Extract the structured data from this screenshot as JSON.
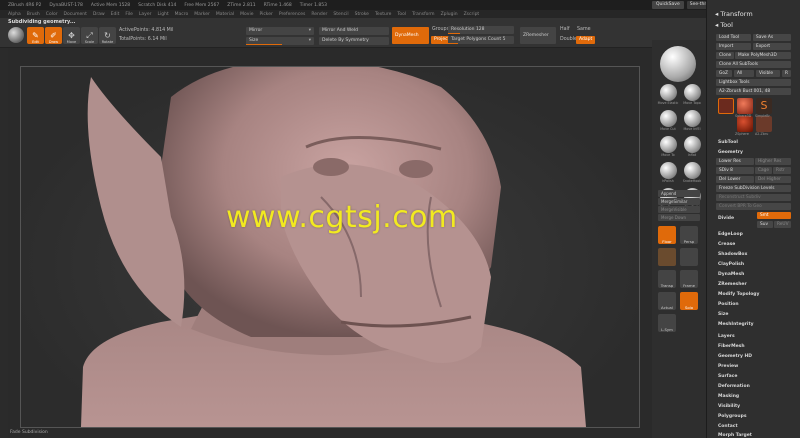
{
  "titlebar": {
    "app": "ZBrush 4R6 P2",
    "doc": "DynaBUST-178",
    "active_mem": "Active Mem 1528",
    "scratch": "Scratch Disk 414",
    "free_mem": "Free Mem 2567",
    "ztime": "ZTime 2.811",
    "rtime": "RTime 1.468",
    "timer": "Timer 1.853",
    "quicksave": "QuickSave",
    "see_through": "See-through",
    "see_through_value": 0,
    "menus": "Menus",
    "script": "DefaultZScript"
  },
  "menubar": [
    "Alpha",
    "Brush",
    "Color",
    "Document",
    "Draw",
    "Edit",
    "File",
    "Layer",
    "Light",
    "Macro",
    "Marker",
    "Material",
    "Movie",
    "Picker",
    "Preferences",
    "Render",
    "Stencil",
    "Stroke",
    "Texture",
    "Tool",
    "Transform",
    "Zplugin",
    "Zscript"
  ],
  "toolbar": {
    "sub_label": "Subdividing geometry...",
    "edit": "Edit",
    "draw": "Draw",
    "move": "Move",
    "scale": "Scale",
    "rotate": "Rotate",
    "active_points": "ActivePoints: 4.814 Mil",
    "total_points": "TotalPoints: 6.14 Mil",
    "mirror": "Mirror",
    "size": "Size",
    "mirror_weld": "Mirror And Weld",
    "delete_sym": "Delete By Symmetry",
    "dynamesh": "DynaMesh",
    "groups": "Groups",
    "project": "Project",
    "resolution": "Resolution 128",
    "target_polygons": "Target Polygons Count 5",
    "zremesher": "ZRemesher",
    "half": "Half",
    "same": "Same",
    "double": "Double",
    "adapt": "Adapt"
  },
  "watermark": "www.cgtsj.com",
  "status": "Fade Subdivision",
  "shelf": {
    "brushes": [
      "Move Elastic",
      "Move Topo",
      "Move Cut",
      "Move InfEl",
      "Move To",
      "Inflat",
      "hPolish",
      "SnakeHook",
      "TrimCurv",
      "ClayBuild"
    ],
    "append": "Append",
    "merge_similar": "MergeSimilar",
    "merge_visible": "MergeVisible",
    "merge_down": "Merge Down",
    "floor": "Floor",
    "persp": "Persp",
    "material": "MatCap",
    "transp": "Transp",
    "frame": "Frame",
    "actual": "Actual",
    "solo": "Solo",
    "lsym": "L.Sym"
  },
  "panel": {
    "transform": "Transform",
    "tool": "Tool",
    "load_tool": "Load Tool",
    "save_as": "Save As",
    "import": "Import",
    "export": "Export",
    "clone": "Clone",
    "make_polymesh": "Make PolyMesh3D",
    "clone_all": "Clone All SubTools",
    "goz": "GoZ",
    "all": "All",
    "visible": "Visible",
    "r": "R",
    "lightbox_tools": "Lightbox Tools",
    "brush_name": "A2-Zbrush Bust 001, 48",
    "thumb_labels": [
      "Sphere3D",
      "SimpleBr",
      "ZSphere",
      "A2-Zbru"
    ],
    "subtool": "SubTool",
    "geometry": "Geometry",
    "lower_res": "Lower Res",
    "higher_res": "Higher Res",
    "sdiv": "SDiv 8",
    "cage": "Cage",
    "rstr": "Rstr",
    "del_lower": "Del Lower",
    "del_higher": "Del Higher",
    "freeze": "Freeze SubDivision Levels",
    "reconstruct": "Reconstruct Subdiv",
    "convert_bpr": "Convert BPR To Geo",
    "divide": "Divide",
    "smt": "Smt",
    "suv": "Suv",
    "reuv": "ReUV",
    "sections": [
      "EdgeLoop",
      "Crease",
      "ShadowBox",
      "ClayPolish",
      "DynaMesh",
      "ZRemesher",
      "Modify Topology",
      "Position",
      "Size",
      "MeshIntegrity"
    ],
    "groups_below": [
      "Layers",
      "FiberMesh",
      "Geometry HD",
      "Preview",
      "Surface",
      "Deformation",
      "Masking",
      "Visibility",
      "Polygroups",
      "Contact",
      "Morph Target"
    ]
  },
  "colors": {
    "accent": "#e06a0a",
    "watermark": "#f2ea20",
    "skin": "#b08a8a"
  }
}
